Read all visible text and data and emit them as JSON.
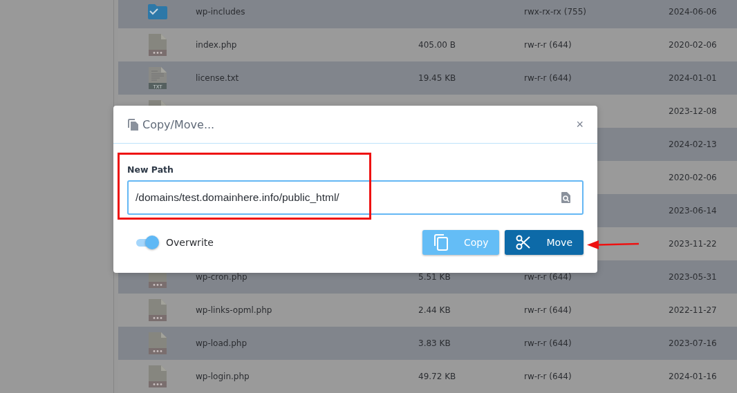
{
  "files": [
    {
      "kind": "folder",
      "name": "wp-includes",
      "permissions": "rwx-rx-rx (755)",
      "modified": "2024-06-06"
    },
    {
      "kind": "file",
      "name": "index.php",
      "size": "405.00 B",
      "permissions": "rw-r-r (644)",
      "modified": "2020-02-06"
    },
    {
      "kind": "text",
      "icon_label": "TXT",
      "name": "license.txt",
      "size": "19.45 KB",
      "permissions": "rw-r-r (644)",
      "modified": "2024-01-01"
    },
    {
      "kind": "file",
      "modified": "2023-12-08"
    },
    {
      "modified": "2024-02-13"
    },
    {
      "modified": "2020-02-06"
    },
    {
      "modified": "2023-06-14"
    },
    {
      "modified": "2023-11-22"
    },
    {
      "kind": "file",
      "name": "wp-cron.php",
      "size": "5.51 KB",
      "permissions": "rw-r-r (644)",
      "modified": "2023-05-31"
    },
    {
      "kind": "file",
      "name": "wp-links-opml.php",
      "size": "2.44 KB",
      "permissions": "rw-r-r (644)",
      "modified": "2022-11-27"
    },
    {
      "kind": "file",
      "name": "wp-load.php",
      "size": "3.83 KB",
      "permissions": "rw-r-r (644)",
      "modified": "2023-07-16"
    },
    {
      "kind": "file",
      "name": "wp-login.php",
      "size": "49.72 KB",
      "permissions": "rw-r-r (644)",
      "modified": "2024-01-16"
    }
  ],
  "dialog": {
    "title": "Copy/Move...",
    "close": "×",
    "field": {
      "label": "New Path",
      "value": "/domains/test.domainhere.info/public_html/"
    },
    "overwrite": {
      "label": "Overwrite",
      "on": true
    },
    "buttons": [
      {
        "kind": "copy",
        "label": "Copy",
        "disabled": true
      },
      {
        "kind": "move",
        "label": "Move",
        "disabled": false
      }
    ]
  }
}
